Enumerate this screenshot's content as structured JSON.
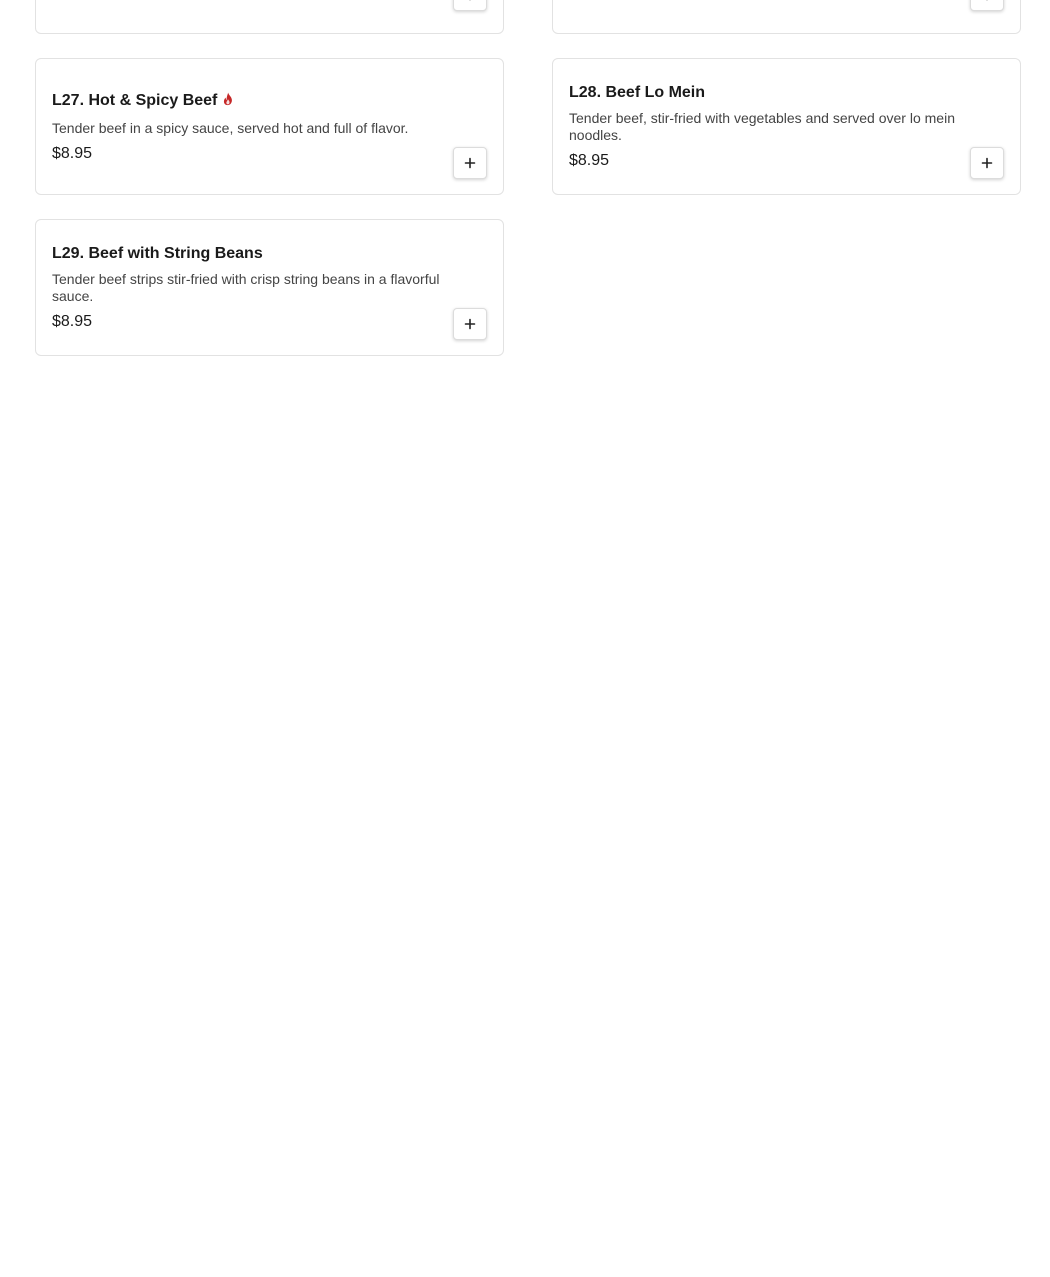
{
  "menu": {
    "items": [
      {
        "code_name": "L27. Hot & Spicy Beef",
        "spicy": true,
        "description": "Tender beef in a spicy sauce, served hot and full of flavor.",
        "price": "$8.95"
      },
      {
        "code_name": "L28. Beef Lo Mein",
        "spicy": false,
        "description": "Tender beef, stir-fried with vegetables and served over lo mein noodles.",
        "price": "$8.95"
      },
      {
        "code_name": "L29. Beef with String Beans",
        "spicy": false,
        "description": "Tender beef strips stir-fried with crisp string beans in a flavorful sauce.",
        "price": "$8.95"
      }
    ],
    "add_icon": "plus-icon",
    "spicy_icon": "flame-icon",
    "spicy_color": "#c62828"
  }
}
